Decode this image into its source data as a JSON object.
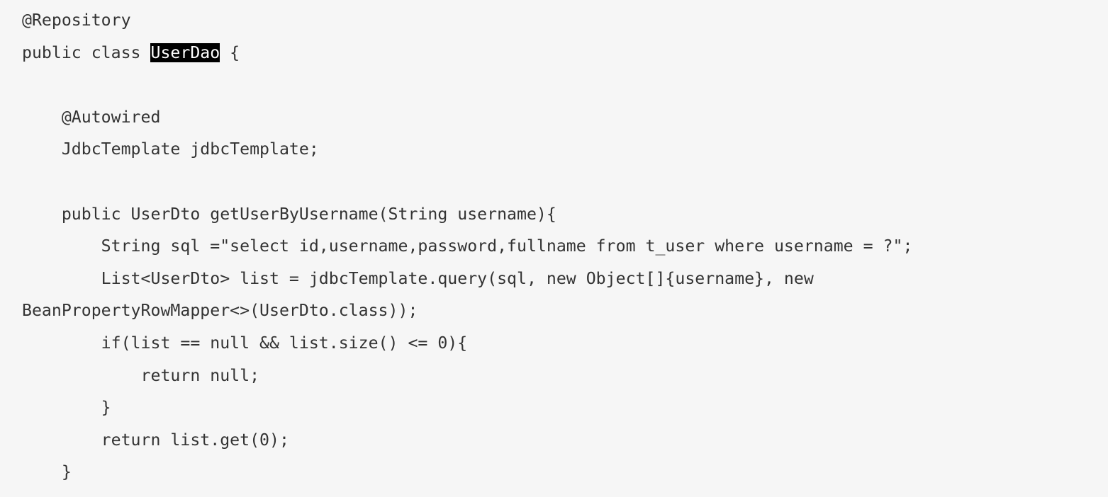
{
  "code": {
    "lines": [
      "@Repository",
      "public class ",
      "",
      "    @Autowired",
      "    JdbcTemplate jdbcTemplate;",
      "",
      "    public UserDto getUserByUsername(String username){",
      "        String sql =\"select id,username,password,fullname from t_user where username = ?\";",
      "        List<UserDto> list = jdbcTemplate.query(sql, new Object[]{username}, new",
      "BeanPropertyRowMapper<>(UserDto.class));",
      "        if(list == null && list.size() <= 0){",
      "            return null;",
      "        }",
      "        return list.get(0);",
      "    }"
    ],
    "selected_text": "UserDao",
    "after_selection": " {"
  },
  "colors": {
    "background": "#f6f6f6",
    "text": "#333333",
    "selection_bg": "#000000",
    "selection_fg": "#ffffff"
  }
}
